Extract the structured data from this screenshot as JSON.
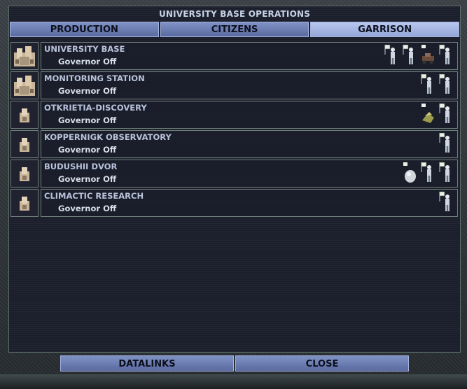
{
  "window": {
    "title": "UNIVERSITY BASE OPERATIONS"
  },
  "tabs": [
    {
      "label": "PRODUCTION",
      "active": false
    },
    {
      "label": "CITIZENS",
      "active": false
    },
    {
      "label": "GARRISON",
      "active": true
    }
  ],
  "bases": [
    {
      "name": "UNIVERSITY BASE",
      "status": "Governor Off",
      "garrison": [
        "trooper",
        "trooper",
        "rover",
        "trooper"
      ]
    },
    {
      "name": "MONITORING STATION",
      "status": "Governor Off",
      "garrison": [
        "trooper",
        "trooper"
      ]
    },
    {
      "name": "OTKRIETIA-DISCOVERY",
      "status": "Governor Off",
      "garrison": [
        "former",
        "trooper"
      ]
    },
    {
      "name": "KOPPERNIGK OBSERVATORY",
      "status": "Governor Off",
      "garrison": [
        "trooper"
      ]
    },
    {
      "name": "BUDUSHII DVOR",
      "status": "Governor Off",
      "garrison": [
        "pod",
        "trooper",
        "trooper"
      ]
    },
    {
      "name": "CLIMACTIC RESEARCH",
      "status": "Governor Off",
      "garrison": [
        "trooper"
      ]
    }
  ],
  "buttons": {
    "datalinks": "DATALINKS",
    "close": "CLOSE"
  }
}
